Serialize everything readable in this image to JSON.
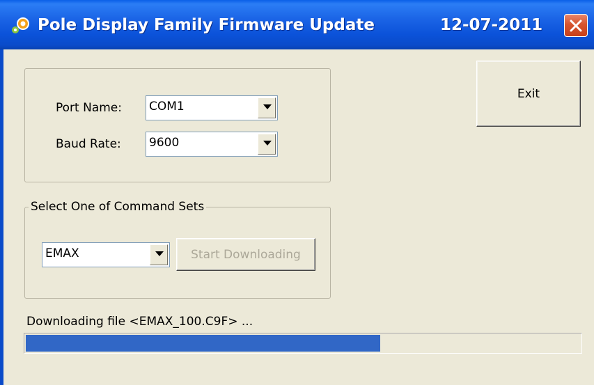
{
  "window": {
    "title": "Pole Display Family Firmware Update",
    "date": "12-07-2011"
  },
  "icons": {
    "app": "app-logo-icon",
    "close": "close-icon",
    "dropdown": "chevron-down-icon"
  },
  "port_group": {
    "port_name_label": "Port Name:",
    "port_name_value": "COM1",
    "baud_rate_label": "Baud Rate:",
    "baud_rate_value": "9600"
  },
  "command_group": {
    "legend": "Select One of Command Sets",
    "command_set_value": "EMAX",
    "start_button_label": "Start Downloading",
    "start_button_enabled": false
  },
  "exit_button_label": "Exit",
  "status": {
    "text": "Downloading file <EMAX_100.C9F> ...",
    "progress": 0.64
  },
  "colors": {
    "titlebar": "#0B52D9",
    "progress_fill": "#3167C6",
    "window_bg": "#ECE9D8",
    "close_button": "#D6552F"
  }
}
